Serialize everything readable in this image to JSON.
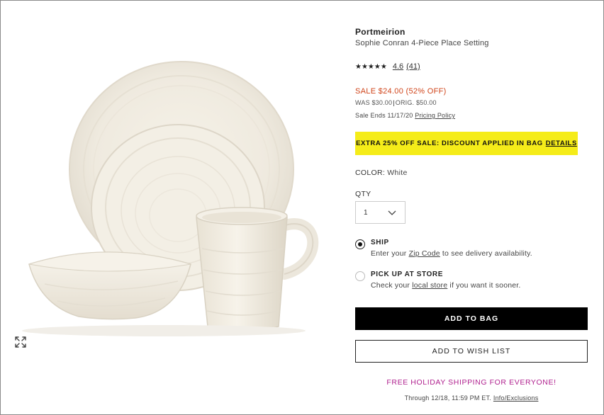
{
  "product": {
    "brand": "Portmeirion",
    "name": "Sophie Conran 4-Piece Place Setting",
    "image_alt": "Sophie Conran 4-Piece Place Setting"
  },
  "rating": {
    "stars_display": "★★★★★",
    "value": "4.6",
    "count": "(41)",
    "stars_fraction": 0.92
  },
  "pricing": {
    "sale_label": "SALE $24.00",
    "discount": "(52% OFF)",
    "was": "WAS $30.00",
    "orig": "ORIG. $50.00",
    "ends_text": "Sale Ends 11/17/20",
    "policy_link": "Pricing Policy"
  },
  "promo_banner": {
    "text": "EXTRA 25% OFF SALE: DISCOUNT APPLIED IN BAG",
    "link": "DETAILS"
  },
  "color": {
    "label": "COLOR:",
    "value": "White"
  },
  "quantity": {
    "label": "QTY",
    "value": "1"
  },
  "fulfillment": {
    "ship": {
      "title": "SHIP",
      "desc_prefix": "Enter your",
      "link": "Zip Code",
      "desc_suffix": "to see delivery availability.",
      "selected": true
    },
    "pickup": {
      "title": "PICK UP AT STORE",
      "desc_prefix": "Check your",
      "link": "local store",
      "desc_suffix": "if you want it sooner.",
      "selected": false
    }
  },
  "actions": {
    "add_to_bag": "ADD TO BAG",
    "add_to_wish_list": "ADD TO WISH LIST"
  },
  "shipping_promo": {
    "headline": "FREE HOLIDAY SHIPPING FOR EVERYONE!",
    "terms": "Through 12/18, 11:59 PM ET.",
    "link": "Info/Exclusions"
  },
  "colors": {
    "sale_red": "#d0451b",
    "banner_yellow": "#f5ec19",
    "promo_magenta": "#b0218f",
    "button_black": "#000000"
  },
  "icons": {
    "zoom": "expand-arrows-icon",
    "dropdown": "chevron-down-icon"
  }
}
